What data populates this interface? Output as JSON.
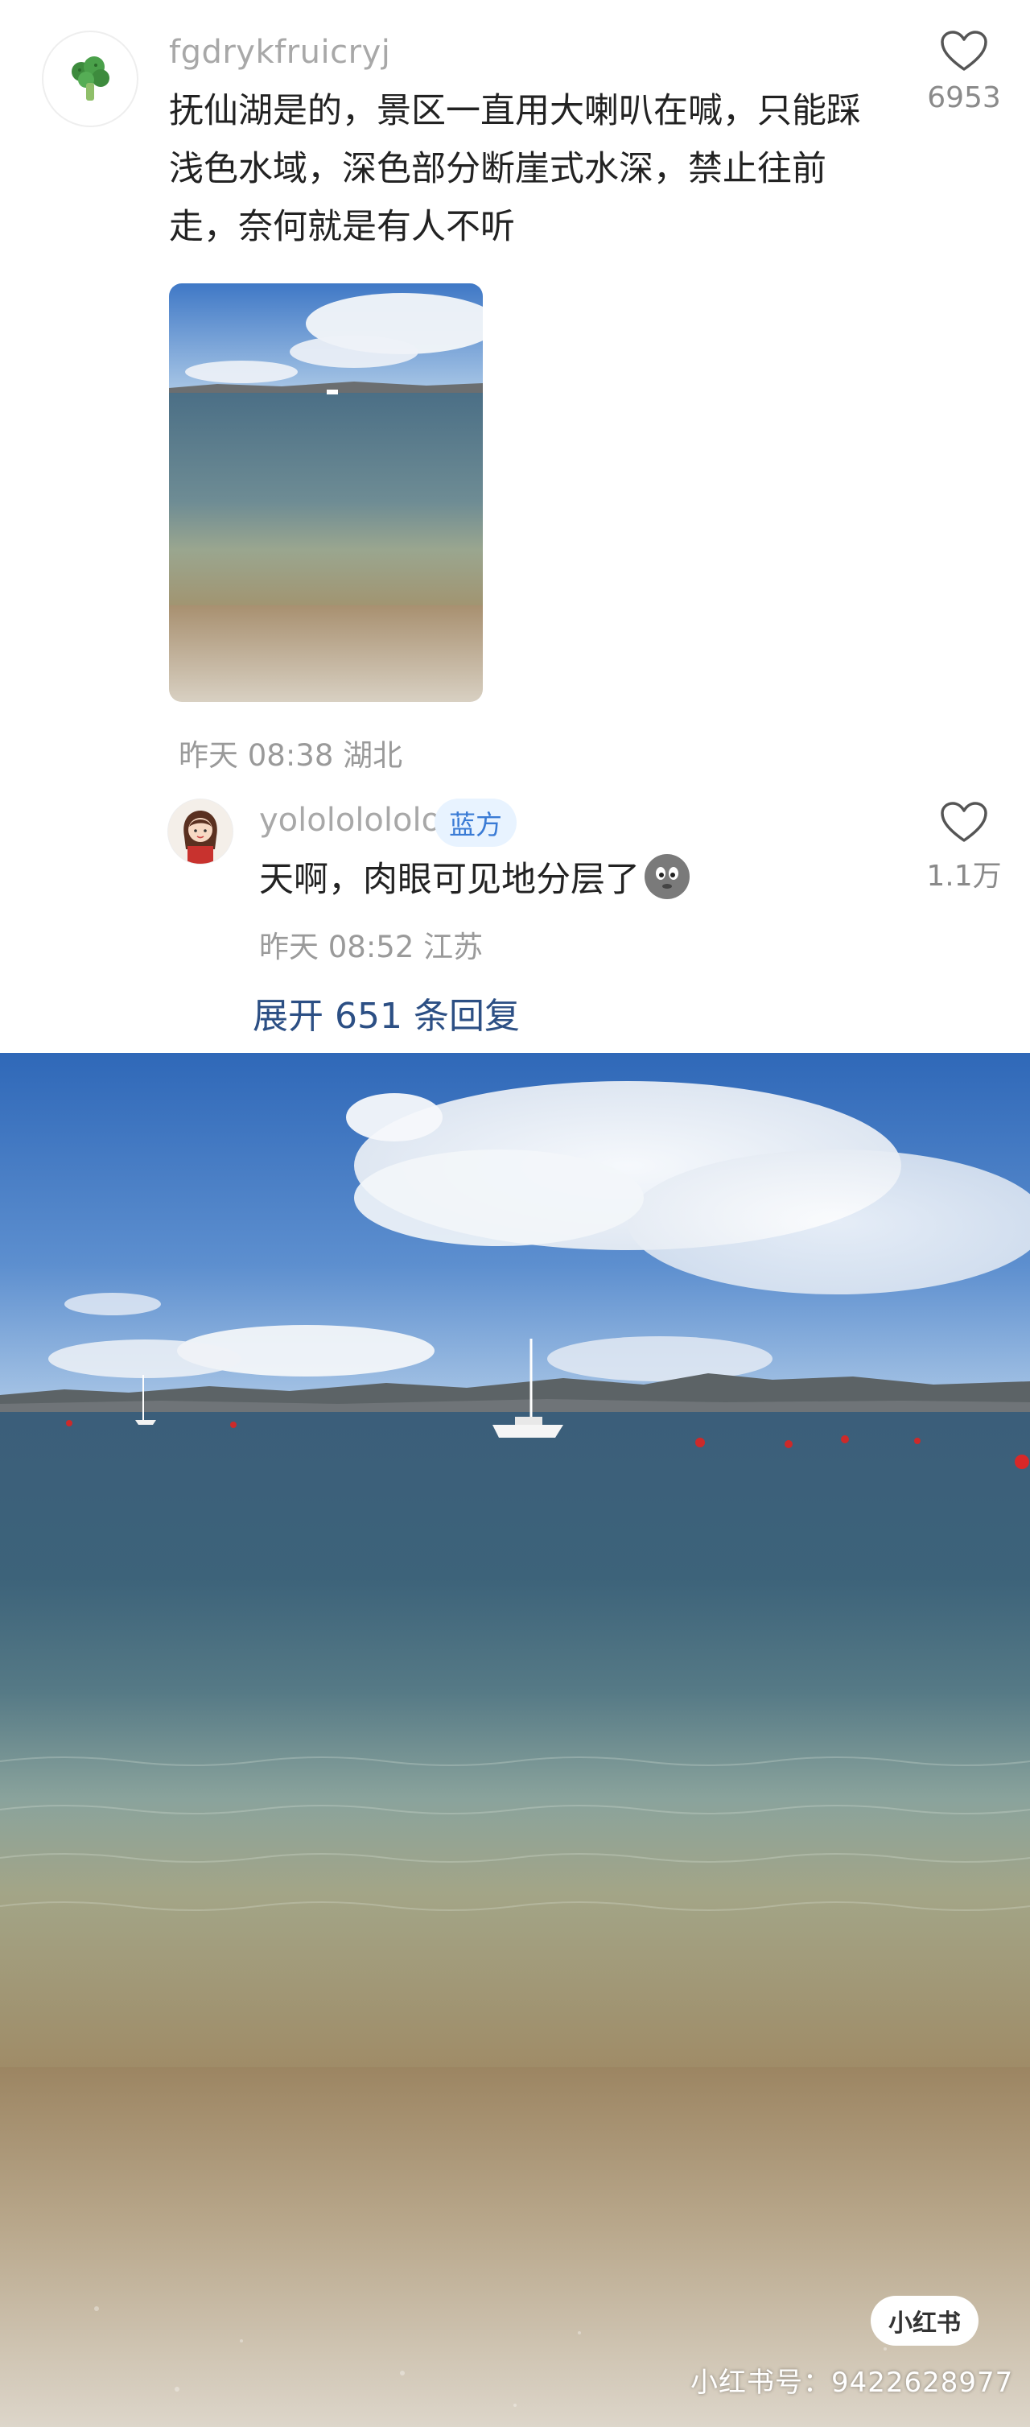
{
  "comment": {
    "username": "fgdrykfruicryj",
    "text": "抚仙湖是的，景区一直用大喇叭在喊，只能踩浅色水域，深色部分断崖式水深，禁止往前走，奈何就是有人不听",
    "like_count": "6953",
    "time": "昨天 08:38",
    "location": "湖北",
    "avatar_icon": "broccoli-icon"
  },
  "reply": {
    "username": "yolololololo",
    "badge": "蓝方",
    "text": "天啊，肉眼可见地分层了",
    "emoji_icon": "grey-face-emoji-icon",
    "like_count": "1.1万",
    "time": "昨天 08:52",
    "location": "江苏"
  },
  "expand_replies": "展开 651 条回复",
  "watermark": {
    "logo": "小红书",
    "text": "小红书号：9422628977"
  },
  "colors": {
    "link": "#2c4f84",
    "badge_bg": "#e8f3ff",
    "badge_text": "#3a7bd5",
    "muted": "#9a9a9a"
  }
}
